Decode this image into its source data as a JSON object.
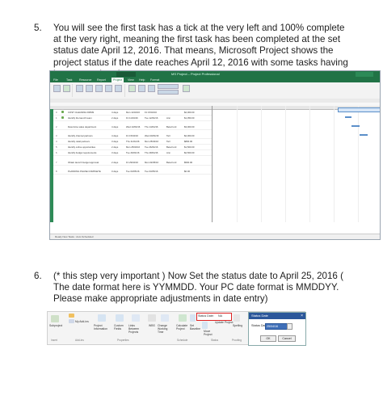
{
  "step5": {
    "number": "5.",
    "text": "You will see the first task has a tick at the very left and 100% complete at the very right, meaning the first task has been completed at the set status date April 12, 2016. That means, Microsoft Project shows the project status if the date reaches April 12, 2016 with some tasks having been completed."
  },
  "step6": {
    "number": "6.",
    "text": "(* this step very important ) Now Set the status date to April 25, 2016 ( The date format here is YYMMDD. Your PC date format is MMDDYY. Please make appropriate adjustments in date entry)"
  },
  "screenshot1": {
    "window_title": "MS Project – Project Professional",
    "tabs": [
      "File",
      "Task",
      "Resource",
      "Report",
      "Project",
      "View",
      "Help",
      "Format"
    ],
    "active_tab": "Project",
    "left_panel_label": "GANTT CHART",
    "status_bar": "Ready   New Tasks : Auto Scheduled",
    "rows": [
      {
        "id": "0",
        "name": "COST CLEANING FIRMS",
        "dur": "4 days",
        "start": "Mon 11/04/16",
        "finish": "Fri 15/04/16",
        "res": "",
        "cost": "$2,000.00"
      },
      {
        "id": "1",
        "name": "Identify the launch team",
        "dur": "2 days",
        "start": "Fri 11/04/16",
        "finish": "Tue 12/04/16",
        "res": "Ann",
        "cost": "$1,050.00"
      },
      {
        "id": "2",
        "name": "Determine sales department",
        "dur": "4 days",
        "start": "Wed 13/04/16",
        "finish": "Thu 14/04/16",
        "res": "Beta Ford",
        "cost": "$3,000.00"
      },
      {
        "id": "3",
        "name": "Identify channel partners",
        "dur": "4 days",
        "start": "Fri 15/04/16",
        "finish": "Wed 20/04/16",
        "res": "Tarl",
        "cost": "$2,000.00"
      },
      {
        "id": "4",
        "name": "Identify retail partners",
        "dur": "3 days",
        "start": "Thu 21/04/16",
        "finish": "Mon 25/04/16",
        "res": "Tarl",
        "cost": "$800.00"
      },
      {
        "id": "5",
        "name": "Identify online opportunities",
        "dur": "2 days",
        "start": "Mon 25/04/16",
        "finish": "Tue 26/04/16",
        "res": "Beta Ford",
        "cost": "$1,500.00"
      },
      {
        "id": "6",
        "name": "Identify budget requirements",
        "dur": "3 days",
        "start": "Tue 26/04/16",
        "finish": "Thu 28/04/16",
        "res": "Ann",
        "cost": "$2,500.00"
      },
      {
        "id": "7",
        "name": "Obtain launch budget approval",
        "dur": "2 days",
        "start": "Fri 29/04/16",
        "finish": "Mon 02/05/16",
        "res": "Beta Ford",
        "cost": "$500.00"
      },
      {
        "id": "8",
        "name": "PLANNING PHASE COMPLETE",
        "dur": "0 days",
        "start": "Tue 03/05/16",
        "finish": "Tue 03/05/16",
        "res": "",
        "cost": "$0.00"
      }
    ]
  },
  "screenshot2": {
    "status_date_label": "Status Date:",
    "status_date_value": "NA",
    "update_project": "Update Project",
    "dialog_title": "Status Date",
    "dialog_field_label": "Status Date:",
    "dialog_field_value": "25/04/16",
    "ok": "OK",
    "cancel": "Cancel",
    "ribbon_items": [
      "Subproject",
      "My Add-ins",
      "Project Information",
      "Custom Fields",
      "Links Between Projects",
      "WBS",
      "Change Working Time",
      "Calculate Project",
      "Set Baseline",
      "Move Project",
      "Spelling"
    ],
    "groups": [
      "Insert",
      "Add-ins",
      "Properties",
      "Schedule",
      "Status",
      "Proofing"
    ]
  }
}
